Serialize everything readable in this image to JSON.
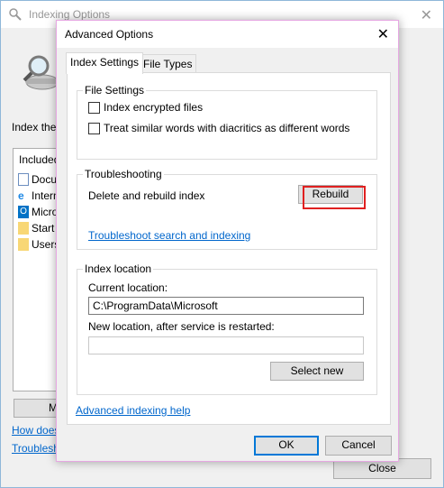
{
  "background_window": {
    "title": "Indexing Options",
    "close_glyph": "✕",
    "index_these": "Index these locations:",
    "list_header": "Included Locations",
    "list_items": [
      {
        "label": "Documents",
        "icon": "document-icon"
      },
      {
        "label": "Internet Explorer History",
        "icon": "internet-explorer-icon"
      },
      {
        "label": "Microsoft Outlook",
        "icon": "outlook-icon"
      },
      {
        "label": "Start Menu",
        "icon": "folder-icon"
      },
      {
        "label": "Users",
        "icon": "folder-icon"
      }
    ],
    "modify_label": "Modify",
    "link_how": "How does indexing affect searches?",
    "link_troubleshoot": "Troubleshoot search and indexing",
    "close_button": "Close"
  },
  "dialog": {
    "title": "Advanced Options",
    "close_glyph": "✕",
    "tabs": [
      {
        "label": "Index Settings",
        "active": true
      },
      {
        "label": "File Types",
        "active": false
      }
    ],
    "file_settings": {
      "title": "File Settings",
      "options": [
        {
          "label": "Index encrypted files",
          "checked": false
        },
        {
          "label": "Treat similar words with diacritics as different words",
          "checked": false
        }
      ]
    },
    "troubleshooting": {
      "title": "Troubleshooting",
      "delete_rebuild_label": "Delete and rebuild index",
      "rebuild_button": "Rebuild",
      "troubleshoot_link": "Troubleshoot search and indexing"
    },
    "index_location": {
      "title": "Index location",
      "current_label": "Current location:",
      "current_value": "C:\\ProgramData\\Microsoft",
      "new_label": "New location, after service is restarted:",
      "new_value": "",
      "select_new_button": "Select new"
    },
    "help_link": "Advanced indexing help",
    "ok_button": "OK",
    "cancel_button": "Cancel"
  },
  "colors": {
    "link": "#0066cc",
    "highlight": "#e02020",
    "dialog_border": "#e6a7e2"
  }
}
